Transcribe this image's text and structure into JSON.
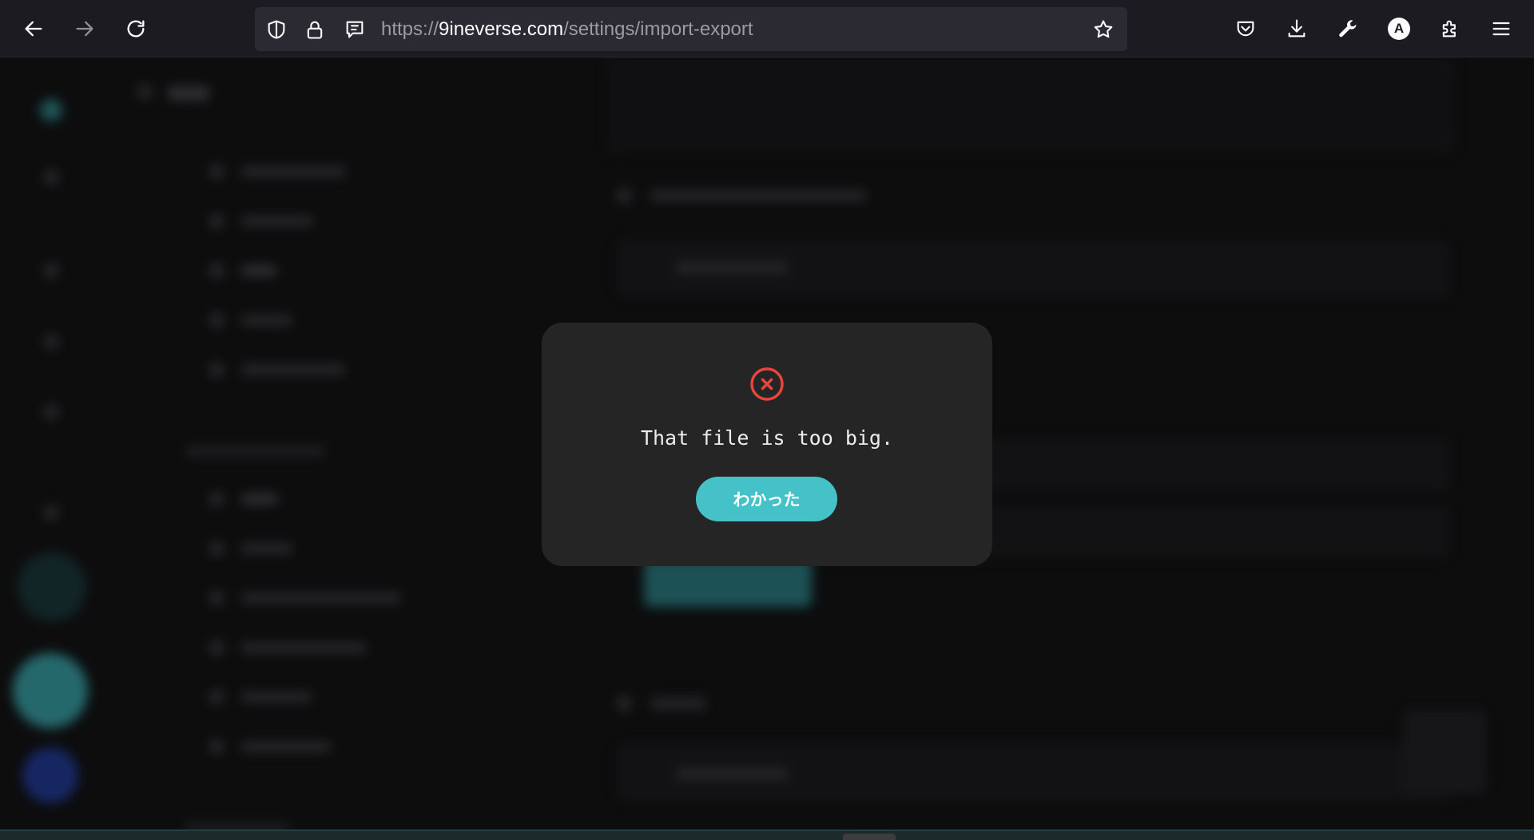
{
  "browser": {
    "url_scheme": "https://",
    "url_host": "9ineverse.com",
    "url_path": "/settings/import-export",
    "profile_initial": "A",
    "icons": {
      "back": "arrow-left-icon",
      "forward": "arrow-right-icon",
      "reload": "reload-icon",
      "tracking": "shield-icon",
      "lock": "lock-icon",
      "reader": "reader-view-icon",
      "bookmark": "star-icon",
      "pocket": "pocket-icon",
      "downloads": "download-icon",
      "devtools": "wrench-icon",
      "extensions": "puzzle-icon",
      "menu": "hamburger-menu-icon"
    }
  },
  "dialog": {
    "message": "That file is too big.",
    "ok_label": "わかった",
    "icon": "error-circle-x-icon",
    "colors": {
      "error": "#e8453c",
      "accent": "#44c2c8",
      "dialog_bg": "#252526"
    }
  }
}
